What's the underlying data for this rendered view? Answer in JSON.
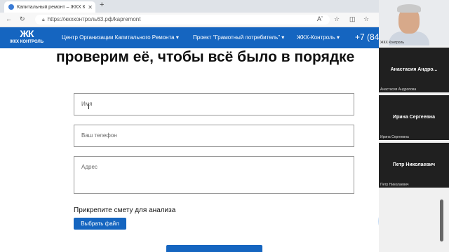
{
  "browser": {
    "tab_title": "Капитальный ремонт – ЖКХ Ко",
    "new_tab": "+",
    "window_controls": "—  ◻",
    "url": "https://жкхконтроль63.рф/kapremont",
    "read_aloud": "Aʼ",
    "favorite_icon": "☆",
    "split_icon": "◫",
    "collections_icon": "☆"
  },
  "site": {
    "logo_mark": "ЖК",
    "logo_name": "ЖКХ КОНТРОЛЬ",
    "nav": [
      {
        "label": "Центр Организации Капитального Ремонта"
      },
      {
        "label": "Проект \"Грамотный потребитель\""
      },
      {
        "label": "ЖКХ-Контроль"
      }
    ],
    "phone": "+7 (84"
  },
  "page": {
    "heading": "проверим её, чтобы всё было в порядке",
    "name_placeholder": "Имя",
    "phone_placeholder": "Ваш телефон",
    "address_placeholder": "Адрес",
    "attach_label": "Прикрепите смету для анализа",
    "file_button": "Выбрать файл",
    "accent_color": "#1565c0"
  },
  "video": {
    "self_caption": "ЖКХ Контроль",
    "participants": [
      {
        "name": "Анастасия  Андро...",
        "caption": "Анастасия Андропова"
      },
      {
        "name": "Ирина Сергеевна",
        "caption": "Ирина Сергеевна"
      },
      {
        "name": "Петр Николаевич",
        "caption": "Петр Николаевич"
      }
    ]
  }
}
